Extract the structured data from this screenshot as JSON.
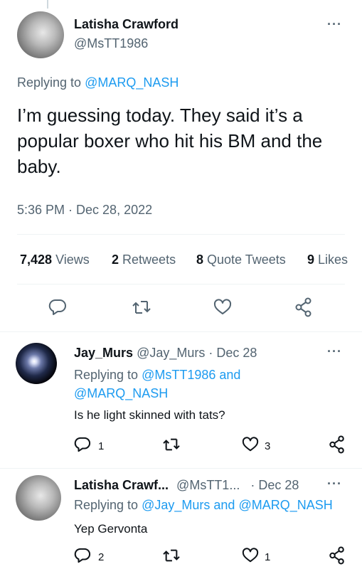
{
  "main_tweet": {
    "author_name": "Latisha Crawford",
    "handle": "@MsTT1986",
    "replying_prefix": "Replying to",
    "replying_to": "@MARQ_NASH",
    "text": "I’m guessing today. They said it’s a popular boxer who hit his BM and the baby.",
    "timestamp": "5:36 PM · Dec 28, 2022",
    "stats": {
      "views_count": "7,428",
      "views_label": "Views",
      "retweets_count": "2",
      "retweets_label": "Retweets",
      "quotes_count": "8",
      "quotes_label": "Quote Tweets",
      "likes_count": "9",
      "likes_label": "Likes"
    },
    "actions": [
      "reply-icon",
      "retweet-icon",
      "like-icon",
      "share-icon"
    ]
  },
  "replies": [
    {
      "author_name": "Jay_Murs",
      "handle": "@Jay_Murs",
      "date": "· Dec 28",
      "replying_prefix": "Replying to",
      "replying_to_1": "@MsTT1986",
      "replying_joiner": "and",
      "replying_to_2": "@MARQ_NASH",
      "text": "Is he light skinned with tats?",
      "reply_count": "1",
      "retweet_count": "",
      "like_count": "3"
    },
    {
      "author_name": "Latisha Crawf...",
      "handle": "@MsTT1...",
      "date": "· Dec 28",
      "replying_prefix": "Replying to",
      "replying_to_1": "@Jay_Murs",
      "replying_joiner": "and",
      "replying_to_2": "@MARQ_NASH",
      "text": "Yep Gervonta",
      "reply_count": "2",
      "retweet_count": "",
      "like_count": "1"
    }
  ],
  "colors": {
    "link": "#1d9bf0",
    "muted": "#536471",
    "text": "#0f1419",
    "divider": "#eff3f4"
  }
}
